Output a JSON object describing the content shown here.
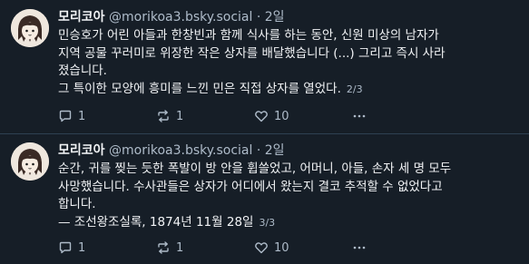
{
  "posts": [
    {
      "author": {
        "display_name": "모리코아",
        "handle": "@morikoa3.bsky.social",
        "separator": "·",
        "time": "2일"
      },
      "lines": [
        "민승호가 어린 아들과 한창빈과 함께 식사를 하는 동안, 신원 미상의 남자가",
        "지역 공물 꾸러미로 위장한 작은 상자를 배달했습니다 (...) 그리고 즉시 사라",
        "졌습니다.",
        "그 특이한 모양에 흥미를 느낀 민은 직접 상자를 열었다."
      ],
      "thread_count": "2/3",
      "stats": {
        "replies": "1",
        "reposts": "1",
        "likes": "10"
      }
    },
    {
      "author": {
        "display_name": "모리코아",
        "handle": "@morikoa3.bsky.social",
        "separator": "·",
        "time": "2일"
      },
      "lines": [
        "순간, 귀를 찢는 듯한 폭발이 방 안을 휩쓸었고, 어머니, 아들, 손자 세 명 모두",
        "사망했습니다. 수사관들은 상자가 어디에서 왔는지 결코 추적할 수 없었다고",
        "합니다.",
        "— 조선왕조실록, 1874년 11월 28일"
      ],
      "thread_count": "3/3",
      "stats": {
        "replies": "1",
        "reposts": "1",
        "likes": "10"
      }
    }
  ],
  "icons": {
    "reply": "reply-icon",
    "repost": "repost-icon",
    "like": "heart-icon",
    "more": "more-icon"
  },
  "colors": {
    "background": "#161e27",
    "text": "#f1f3f5",
    "muted": "#aebbc9",
    "divider": "#2e4052"
  }
}
